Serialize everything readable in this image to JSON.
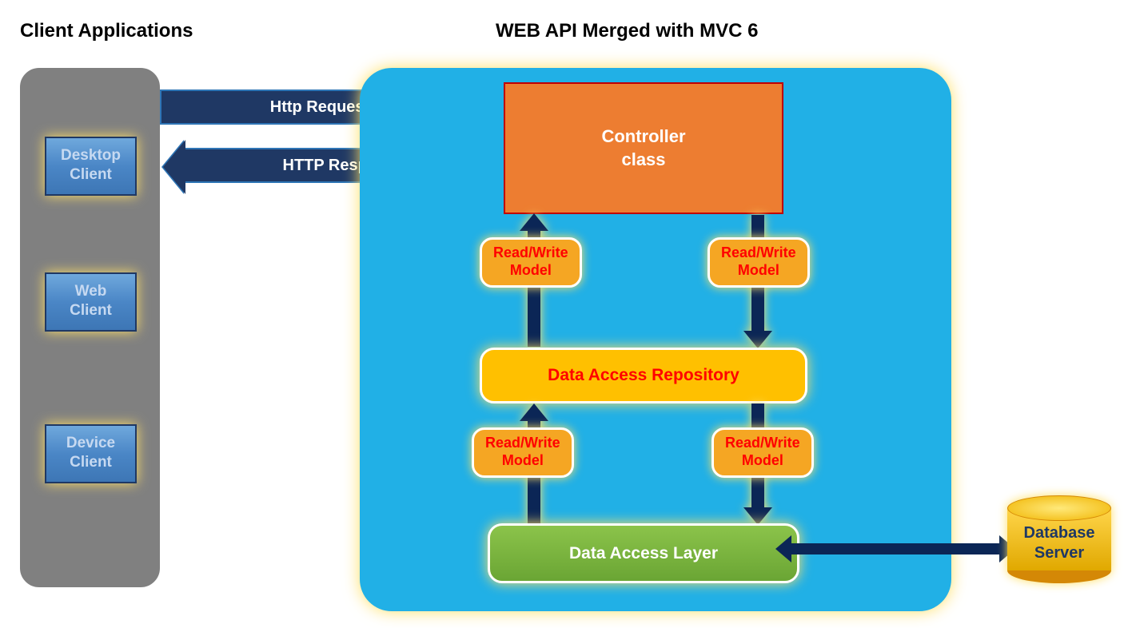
{
  "titles": {
    "clients": "Client Applications",
    "main": "WEB API Merged with MVC 6"
  },
  "clients": {
    "desktop": "Desktop\nClient",
    "web": "Web\nClient",
    "device": "Device\nClient"
  },
  "arrows": {
    "http_request": "Http Request",
    "http_response": "HTTP Response",
    "rw_model": "Read/Write\nModel"
  },
  "boxes": {
    "controller": "Controller\nclass",
    "repository": "Data Access Repository",
    "dal": "Data Access Layer"
  },
  "database": "Database\nServer",
  "colors": {
    "panel_gray": "#808080",
    "panel_blue": "#21b0e6",
    "arrow_navy": "#1f3864",
    "controller_orange": "#ed7d31",
    "controller_border_red": "#c00000",
    "repo_yellow": "#ffc000",
    "dal_green": "#6aa534",
    "badge_orange": "#f5a623",
    "glow_yellow": "#ffe066"
  }
}
